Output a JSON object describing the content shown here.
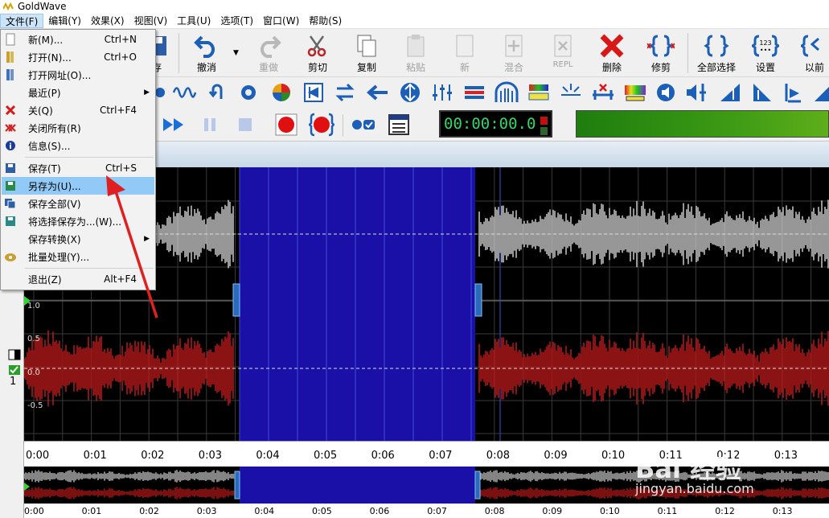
{
  "app": {
    "title": "GoldWave"
  },
  "menu": [
    "文件(F)",
    "编辑(Y)",
    "效果(X)",
    "视图(V)",
    "工具(U)",
    "选项(T)",
    "窗口(W)",
    "帮助(S)"
  ],
  "toolbar": {
    "partial_label": "存",
    "undo": "撤消",
    "redo": "重做",
    "cut": "剪切",
    "copy": "复制",
    "paste": "粘贴",
    "new": "新",
    "mix": "混合",
    "repl": "REPL",
    "delete": "删除",
    "trim": "修剪",
    "select_all": "全部选择",
    "settings": "设置",
    "prev": "以前",
    "settings_icon_text": "123"
  },
  "time_display": "00:00:00.0",
  "file_menu": [
    {
      "label": "新(M)...",
      "shortcut": "Ctrl+N",
      "icon": "new-file-icon"
    },
    {
      "label": "打开(N)...",
      "shortcut": "Ctrl+O",
      "icon": "open-icon"
    },
    {
      "label": "打开网址(O)...",
      "shortcut": "",
      "icon": "open-url-icon"
    },
    {
      "label": "最近(P)",
      "shortcut": "",
      "icon": "",
      "submenu": true
    },
    {
      "label": "关(Q)",
      "shortcut": "Ctrl+F4",
      "icon": "close-icon"
    },
    {
      "label": "关闭所有(R)",
      "shortcut": "",
      "icon": "close-all-icon"
    },
    {
      "label": "信息(S)...",
      "shortcut": "",
      "icon": "info-icon"
    },
    {
      "label": "保存(T)",
      "shortcut": "Ctrl+S",
      "icon": "save-icon"
    },
    {
      "label": "另存为(U)...",
      "shortcut": "",
      "icon": "save-as-icon",
      "highlighted": true
    },
    {
      "label": "保存全部(V)",
      "shortcut": "",
      "icon": "save-all-icon"
    },
    {
      "label": "将选择保存为...(W)...",
      "shortcut": "",
      "icon": "save-selection-icon"
    },
    {
      "label": "保存转换(X)",
      "shortcut": "",
      "icon": "",
      "submenu": true
    },
    {
      "label": "批量处理(Y)...",
      "shortcut": "",
      "icon": "batch-icon"
    },
    {
      "label": "退出(Z)",
      "shortcut": "Alt+F4",
      "icon": ""
    }
  ],
  "amp_labels": [
    "1.0",
    "0.5",
    "0.0",
    "-0.5"
  ],
  "timeline": [
    "0:00",
    "0:01",
    "0:02",
    "0:03",
    "0:04",
    "0:05",
    "0:06",
    "0:07",
    "0:08",
    "0:09",
    "0:10",
    "0:11",
    "0:12",
    "0:13"
  ],
  "overview_timeline": [
    "0:00",
    "0:01",
    "0:02",
    "0:03",
    "0:04",
    "0:05",
    "0:06",
    "0:07",
    "0:08",
    "0:09",
    "0:10",
    "0:11",
    "0:12",
    "0:13"
  ],
  "channel_number": "1",
  "watermark": {
    "line1": "Bai 经验",
    "line2": "jingyan.baidu.com"
  },
  "colors": {
    "selection": "#1a10a8",
    "left_channel": "#bdbdbd",
    "right_channel": "#b01818",
    "highlight": "#91c9f7"
  }
}
